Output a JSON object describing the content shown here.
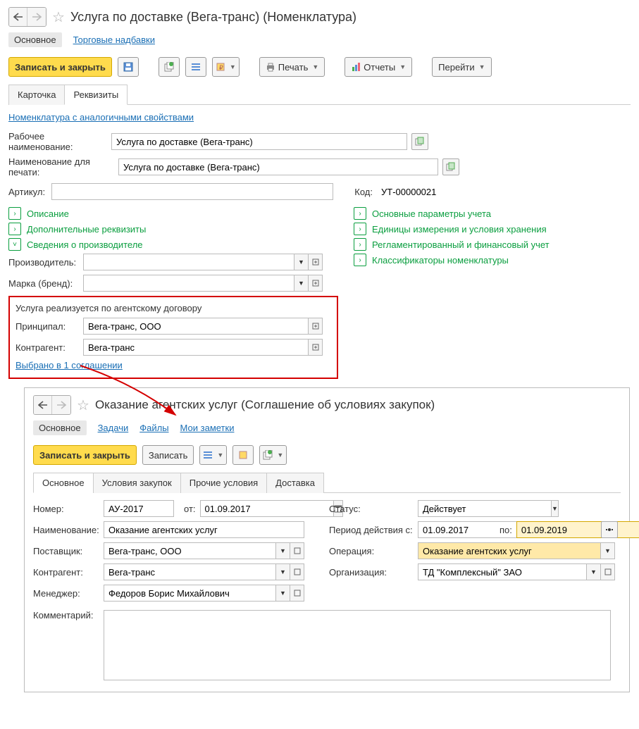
{
  "top": {
    "title": "Услуга по доставке (Вега-транс) (Номенклатура)",
    "nav": {
      "main": "Основное",
      "markup": "Торговые надбавки"
    },
    "toolbar": {
      "save_close": "Записать и закрыть",
      "print": "Печать",
      "reports": "Отчеты",
      "goto": "Перейти"
    },
    "tabs": {
      "card": "Карточка",
      "props": "Реквизиты"
    },
    "similar_link": "Номенклатура с аналогичными свойствами",
    "labels": {
      "work_name": "Рабочее наименование:",
      "print_name": "Наименование для печати:",
      "sku": "Артикул:",
      "code": "Код:"
    },
    "values": {
      "work_name": "Услуга по доставке (Вега-транс)",
      "print_name": "Услуга по доставке (Вега-транс)",
      "sku": "",
      "code": "УТ-00000021"
    },
    "sections": {
      "desc": "Описание",
      "extra": "Дополнительные реквизиты",
      "manuf_info": "Сведения о производителе",
      "params": "Основные параметры учета",
      "units": "Единицы измерения и условия хранения",
      "reglament": "Регламентированный и финансовый учет",
      "classifiers": "Классификаторы номенклатуры"
    },
    "manuf": {
      "manufacturer": "Производитель:",
      "brand": "Марка (бренд):",
      "manufacturer_val": "",
      "brand_val": ""
    },
    "agent": {
      "header": "Услуга реализуется по агентскому договору",
      "principal_lbl": "Принципал:",
      "principal": "Вега-транс, ООО",
      "contractor_lbl": "Контрагент:",
      "contractor": "Вега-транс",
      "selected_link": "Выбрано в 1 соглашении"
    }
  },
  "agr": {
    "title": "Оказание агентских услуг (Соглашение об условиях закупок)",
    "nav": {
      "main": "Основное",
      "tasks": "Задачи",
      "files": "Файлы",
      "notes": "Мои заметки"
    },
    "toolbar": {
      "save_close": "Записать и закрыть",
      "save": "Записать"
    },
    "tabs": {
      "main": "Основное",
      "cond": "Условия закупок",
      "other": "Прочие условия",
      "delivery": "Доставка"
    },
    "labels": {
      "number": "Номер:",
      "from": "от:",
      "name": "Наименование:",
      "supplier": "Поставщик:",
      "contractor": "Контрагент:",
      "manager": "Менеджер:",
      "comment": "Комментарий:",
      "status": "Статус:",
      "period": "Период действия с:",
      "to": "по:",
      "operation": "Операция:",
      "org": "Организация:"
    },
    "values": {
      "number": "АУ-2017",
      "from": "01.09.2017",
      "name": "Оказание агентских услуг",
      "supplier": "Вега-транс, ООО",
      "contractor": "Вега-транс",
      "manager": "Федоров Борис Михайлович",
      "comment": "",
      "status": "Действует",
      "period_from": "01.09.2017",
      "period_to": "01.09.2019",
      "operation": "Оказание агентских услуг",
      "org": "ТД \"Комплексный\" ЗАО"
    }
  }
}
